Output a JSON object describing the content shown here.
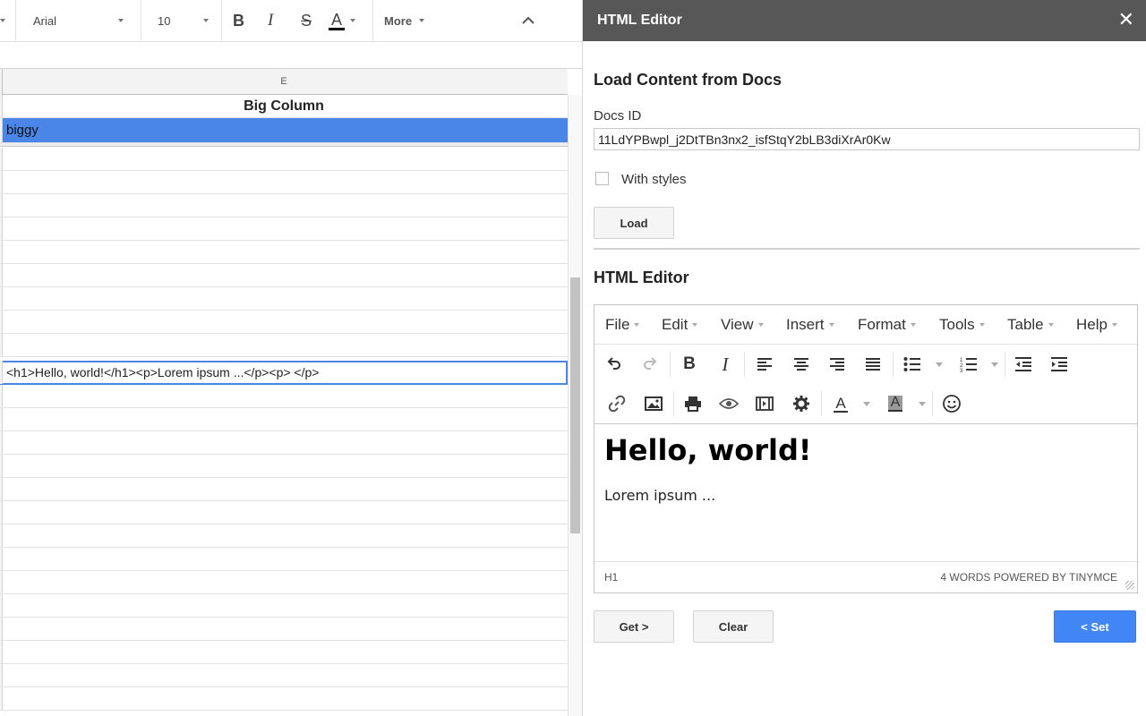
{
  "toolbar": {
    "font": "Arial",
    "font_size": "10",
    "more_label": "More"
  },
  "sheet": {
    "column_letter": "E",
    "header_cell": "Big Column",
    "selected_cell": "biggy",
    "active_cell": "<h1>Hello, world!</h1><p>Lorem ipsum ...</p><p> </p>"
  },
  "sidebar": {
    "title": "HTML Editor",
    "load_section_title": "Load Content from Docs",
    "docs_id_label": "Docs ID",
    "docs_id_value": "11LdYPBwpl_j2DtTBn3nx2_isfStqY2bLB3diXrAr0Kw",
    "with_styles_label": "With styles",
    "with_styles_checked": false,
    "load_button": "Load",
    "editor_section_title": "HTML Editor",
    "get_button": "Get >",
    "clear_button": "Clear",
    "set_button": "< Set"
  },
  "editor": {
    "menus": [
      "File",
      "Edit",
      "View",
      "Insert",
      "Format",
      "Tools",
      "Table",
      "Help"
    ],
    "content_heading": "Hello, world!",
    "content_paragraph": "Lorem ipsum ...",
    "status_path": "H1",
    "status_info": "4 WORDS POWERED BY TINYMCE"
  },
  "colors": {
    "selection_blue": "#4a86e8",
    "primary_button": "#4285f4",
    "sidebar_title_bg": "#575757"
  }
}
